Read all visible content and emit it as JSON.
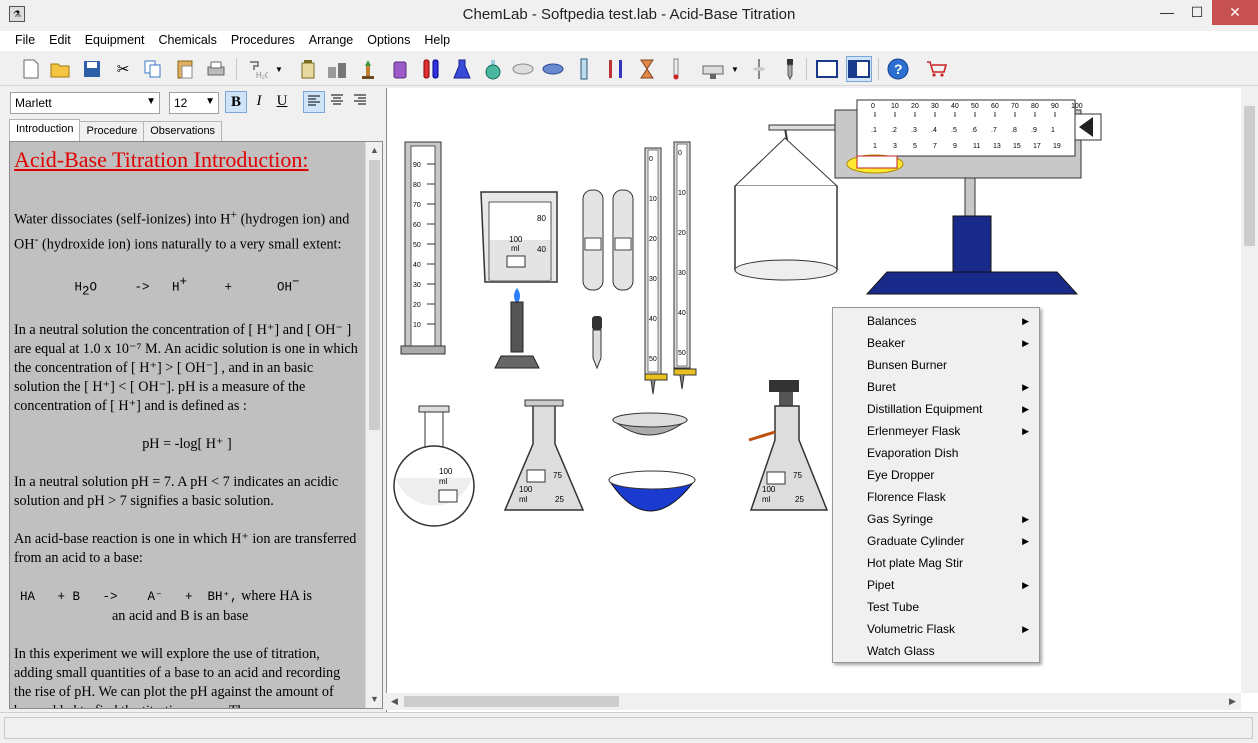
{
  "window": {
    "title": "ChemLab - Softpedia test.lab - Acid-Base Titration"
  },
  "menubar": [
    "File",
    "Edit",
    "Equipment",
    "Chemicals",
    "Procedures",
    "Arrange",
    "Options",
    "Help"
  ],
  "format": {
    "font": "Marlett",
    "size": "12"
  },
  "tabs": [
    "Introduction",
    "Procedure",
    "Observations"
  ],
  "doc": {
    "heading": "Acid-Base Titration Introduction:",
    "p1a": "Water dissociates (self-ionizes) into H",
    "p1b": "+",
    "p1c": " (hydrogen ion) and OH",
    "p1d": "-",
    "p1e": " (hydroxide ion) ions naturally to a very small extent:",
    "eq1a": "H",
    "eq1b": "2",
    "eq1c": "O     ->   H",
    "eq1d": "+",
    "eq1e": "     +      OH",
    "eq1f": "−",
    "p2": "In a neutral solution  the concentration of [ H⁺] and [ OH⁻ ]  are equal at 1.0 x 10⁻⁷ M. An acidic solution is one in which the concentration of  [ H⁺] >  [ OH⁻] , and in an basic solution the [ H⁺]  <  [ OH⁻].  pH  is a measure of the concentration of [ H⁺] and is defined as :",
    "eq2": "pH = -log[ H⁺ ]",
    "p3": "In a neutral solution pH = 7.  A  pH < 7 indicates an acidic solution and pH > 7 signifies a basic solution.",
    "p4": "An acid-base reaction is one in which  H⁺  ion are transferred from an acid to a base:",
    "eq3a": "HA   + B   ->    A⁻   +  BH⁺,",
    "eq3b": "where HA is",
    "eq3c": "an acid and B is an base",
    "p5": "In this experiment we will explore the use of titration, adding small quantities of a base to an acid and recording the rise of  pH. We can plot the pH against the amount of base added to find the titration curve. The"
  },
  "context_menu": [
    {
      "label": "Balances",
      "submenu": true
    },
    {
      "label": "Beaker",
      "submenu": true
    },
    {
      "label": "Bunsen Burner",
      "submenu": false
    },
    {
      "label": "Buret",
      "submenu": true
    },
    {
      "label": "Distillation Equipment",
      "submenu": true
    },
    {
      "label": "Erlenmeyer Flask",
      "submenu": true
    },
    {
      "label": "Evaporation Dish",
      "submenu": false
    },
    {
      "label": "Eye Dropper",
      "submenu": false
    },
    {
      "label": "Florence Flask",
      "submenu": false
    },
    {
      "label": "Gas Syringe",
      "submenu": true
    },
    {
      "label": "Graduate Cylinder",
      "submenu": true
    },
    {
      "label": "Hot plate  Mag Stir",
      "submenu": false
    },
    {
      "label": "Pipet",
      "submenu": true
    },
    {
      "label": "Test Tube",
      "submenu": false
    },
    {
      "label": "Volumetric Flask",
      "submenu": true
    },
    {
      "label": "Watch Glass",
      "submenu": false
    }
  ],
  "canvas": {
    "cylinder_ticks": [
      "90",
      "80",
      "70",
      "60",
      "50",
      "40",
      "30",
      "20",
      "10"
    ],
    "beaker_labels": [
      "80",
      "100",
      "ml",
      "40"
    ],
    "buret_ticks": [
      "0",
      "10",
      "20",
      "30",
      "40",
      "50"
    ],
    "balance_top": [
      "0",
      "10",
      "20",
      "30",
      "40",
      "50",
      "60",
      "70",
      "80",
      "90",
      "100"
    ],
    "balance_mid": [
      ".1",
      ".2",
      ".3",
      ".4",
      ".5",
      ".6",
      ".7",
      ".8",
      ".9",
      "1"
    ],
    "balance_bot": [
      "1",
      "3",
      "5",
      "7",
      "9",
      "11",
      "13",
      "15",
      "17",
      "19"
    ],
    "florence_labels": [
      "100",
      "ml"
    ],
    "erlenmeyer_labels": [
      "75",
      "100",
      "ml",
      "25"
    ],
    "filter_flask_labels": [
      "75",
      "100",
      "ml",
      "25"
    ]
  },
  "colors": {
    "heading": "#e00000",
    "burner_flame": "#2a7fff",
    "balance_base": "#1a2a8a",
    "dish": "#1a3ad0"
  }
}
